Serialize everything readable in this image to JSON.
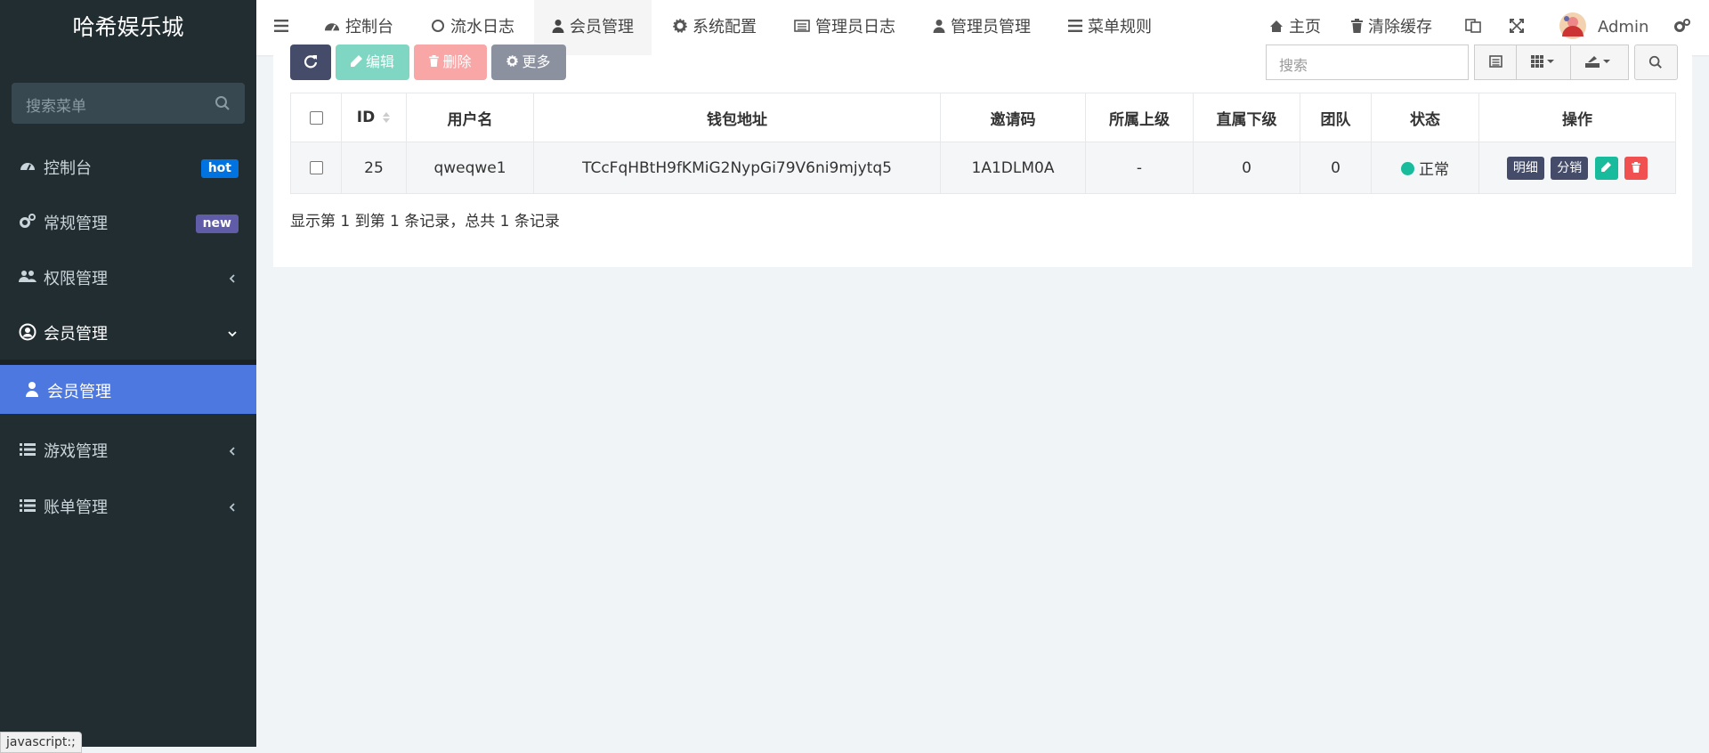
{
  "app": {
    "title": "哈希娱乐城"
  },
  "sidebar": {
    "search_placeholder": "搜索菜单",
    "items": [
      {
        "label": "控制台",
        "badge": "hot",
        "badge_color": "#0073e0"
      },
      {
        "label": "常规管理",
        "badge": "new",
        "badge_color": "#605ca8"
      },
      {
        "label": "权限管理"
      },
      {
        "label": "会员管理"
      },
      {
        "label": "会员管理"
      },
      {
        "label": "游戏管理"
      },
      {
        "label": "账单管理"
      }
    ]
  },
  "tooltip": "javascript:;",
  "topnav": {
    "tabs": [
      "控制台",
      "流水日志",
      "会员管理",
      "系统配置",
      "管理员日志",
      "管理员管理",
      "菜单规则"
    ],
    "home": "主页",
    "clear_cache": "清除缓存",
    "user": "Admin"
  },
  "toolbar": {
    "edit": "编辑",
    "delete": "删除",
    "more": "更多",
    "search_placeholder": "搜索"
  },
  "table": {
    "headers": [
      "ID",
      "用户名",
      "钱包地址",
      "邀请码",
      "所属上级",
      "直属下级",
      "团队",
      "状态",
      "操作"
    ],
    "rows": [
      {
        "id": "25",
        "username": "qweqwe1",
        "wallet": "TCcFqHBtH9fKMiG2NypGi79V6ni9mjytq5",
        "invite": "1A1DLM0A",
        "parent": "-",
        "direct": "0",
        "team": "0",
        "status": "正常",
        "detail": "明细",
        "distribute": "分销"
      }
    ]
  },
  "pagination": {
    "text": "显示第 1 到第 1 条记录，总共 1 条记录"
  },
  "colors": {
    "sidebar_bg": "#222d32",
    "active_item": "#4c78e0",
    "success": "#18bc9c",
    "danger": "#f05050",
    "primary_dark": "#444c69"
  }
}
